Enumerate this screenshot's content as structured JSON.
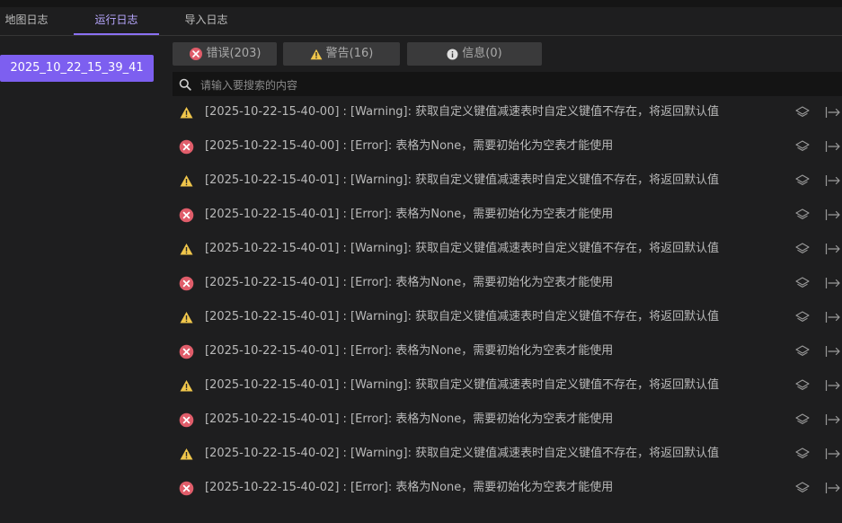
{
  "tabs": [
    {
      "label": "地图日志",
      "active": false
    },
    {
      "label": "运行日志",
      "active": true
    },
    {
      "label": "导入日志",
      "active": false
    }
  ],
  "sidebar": {
    "sessions": [
      {
        "label": "2025_10_22_15_39_41",
        "selected": true
      }
    ]
  },
  "filters": {
    "error": {
      "label": "错误(203)",
      "icon": "error-circle-icon"
    },
    "warning": {
      "label": "警告(16)",
      "icon": "warning-triangle-icon"
    },
    "info": {
      "label": "信息(0)",
      "icon": "info-circle-icon"
    }
  },
  "search": {
    "placeholder": "请输入要搜索的内容",
    "value": ""
  },
  "colors": {
    "accent": "#7d5ff0",
    "error": "#e05d6a",
    "warning": "#f0c64b",
    "info": "#e0e0e0"
  },
  "logs": [
    {
      "level": "warning",
      "text": "[2025-10-22-15-40-00] : [Warning]: 获取自定义键值减速表时自定义键值不存在，将返回默认值"
    },
    {
      "level": "error",
      "text": "[2025-10-22-15-40-00] : [Error]: 表格为None，需要初始化为空表才能使用"
    },
    {
      "level": "warning",
      "text": "[2025-10-22-15-40-01] : [Warning]: 获取自定义键值减速表时自定义键值不存在，将返回默认值"
    },
    {
      "level": "error",
      "text": "[2025-10-22-15-40-01] : [Error]: 表格为None，需要初始化为空表才能使用"
    },
    {
      "level": "warning",
      "text": "[2025-10-22-15-40-01] : [Warning]: 获取自定义键值减速表时自定义键值不存在，将返回默认值"
    },
    {
      "level": "error",
      "text": "[2025-10-22-15-40-01] : [Error]: 表格为None，需要初始化为空表才能使用"
    },
    {
      "level": "warning",
      "text": "[2025-10-22-15-40-01] : [Warning]: 获取自定义键值减速表时自定义键值不存在，将返回默认值"
    },
    {
      "level": "error",
      "text": "[2025-10-22-15-40-01] : [Error]: 表格为None，需要初始化为空表才能使用"
    },
    {
      "level": "warning",
      "text": "[2025-10-22-15-40-01] : [Warning]: 获取自定义键值减速表时自定义键值不存在，将返回默认值"
    },
    {
      "level": "error",
      "text": "[2025-10-22-15-40-01] : [Error]: 表格为None，需要初始化为空表才能使用"
    },
    {
      "level": "warning",
      "text": "[2025-10-22-15-40-02] : [Warning]: 获取自定义键值减速表时自定义键值不存在，将返回默认值"
    },
    {
      "level": "error",
      "text": "[2025-10-22-15-40-02] : [Error]: 表格为None，需要初始化为空表才能使用"
    }
  ]
}
